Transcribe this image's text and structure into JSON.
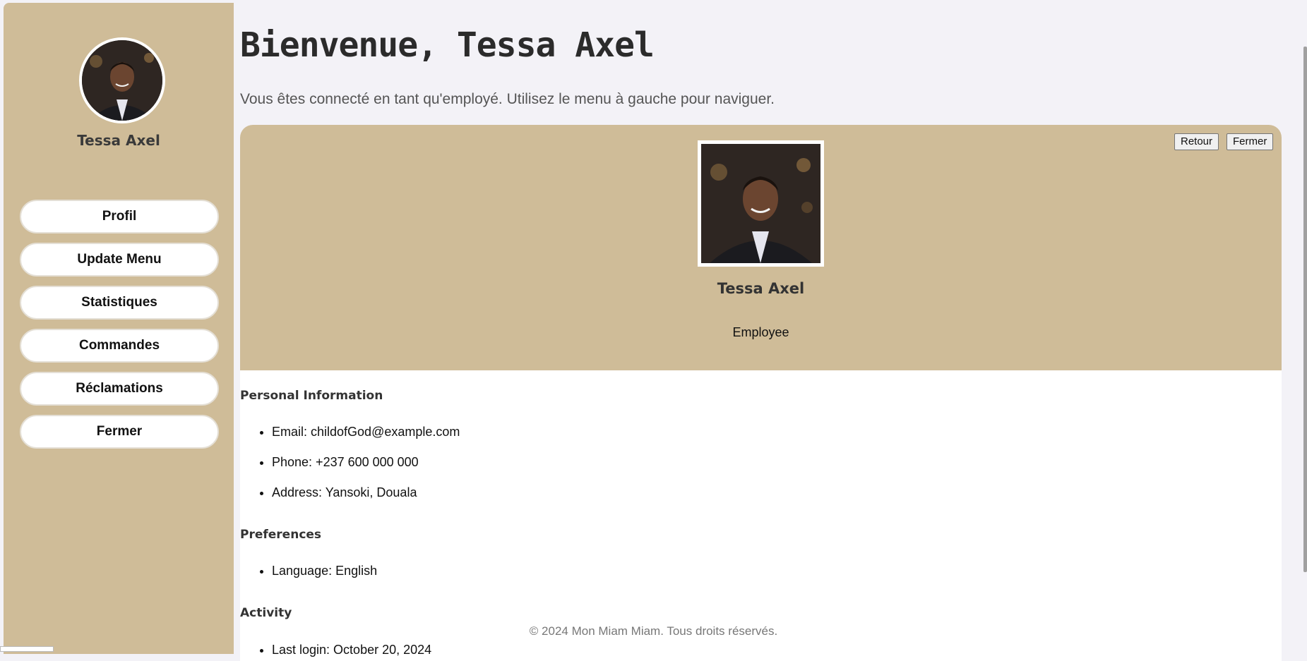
{
  "user": {
    "name": "Tessa Axel",
    "role": "Employee"
  },
  "sidebar": {
    "items": [
      {
        "label": "Profil"
      },
      {
        "label": "Update Menu"
      },
      {
        "label": "Statistiques"
      },
      {
        "label": "Commandes"
      },
      {
        "label": "Réclamations"
      },
      {
        "label": "Fermer"
      }
    ]
  },
  "header": {
    "title": "Bienvenue, Tessa Axel",
    "subtitle": "Vous êtes connecté en tant qu'employé. Utilisez le menu à gauche pour naviguer."
  },
  "profile_card": {
    "back_label": "Retour",
    "close_label": "Fermer",
    "sections": {
      "personal": {
        "title": "Personal Information",
        "items": [
          "Email: childofGod@example.com",
          "Phone: +237 600 000 000",
          "Address: Yansoki, Douala"
        ]
      },
      "preferences": {
        "title": "Preferences",
        "items": [
          "Language: English"
        ]
      },
      "activity": {
        "title": "Activity",
        "items": [
          "Last login: October 20, 2024"
        ]
      }
    }
  },
  "footer": {
    "text": "© 2024 Mon Miam Miam. Tous droits réservés."
  },
  "colors": {
    "sidebar_bg": "#cfbc98",
    "page_bg": "#f3f2f7",
    "card_bg": "#ffffff"
  }
}
